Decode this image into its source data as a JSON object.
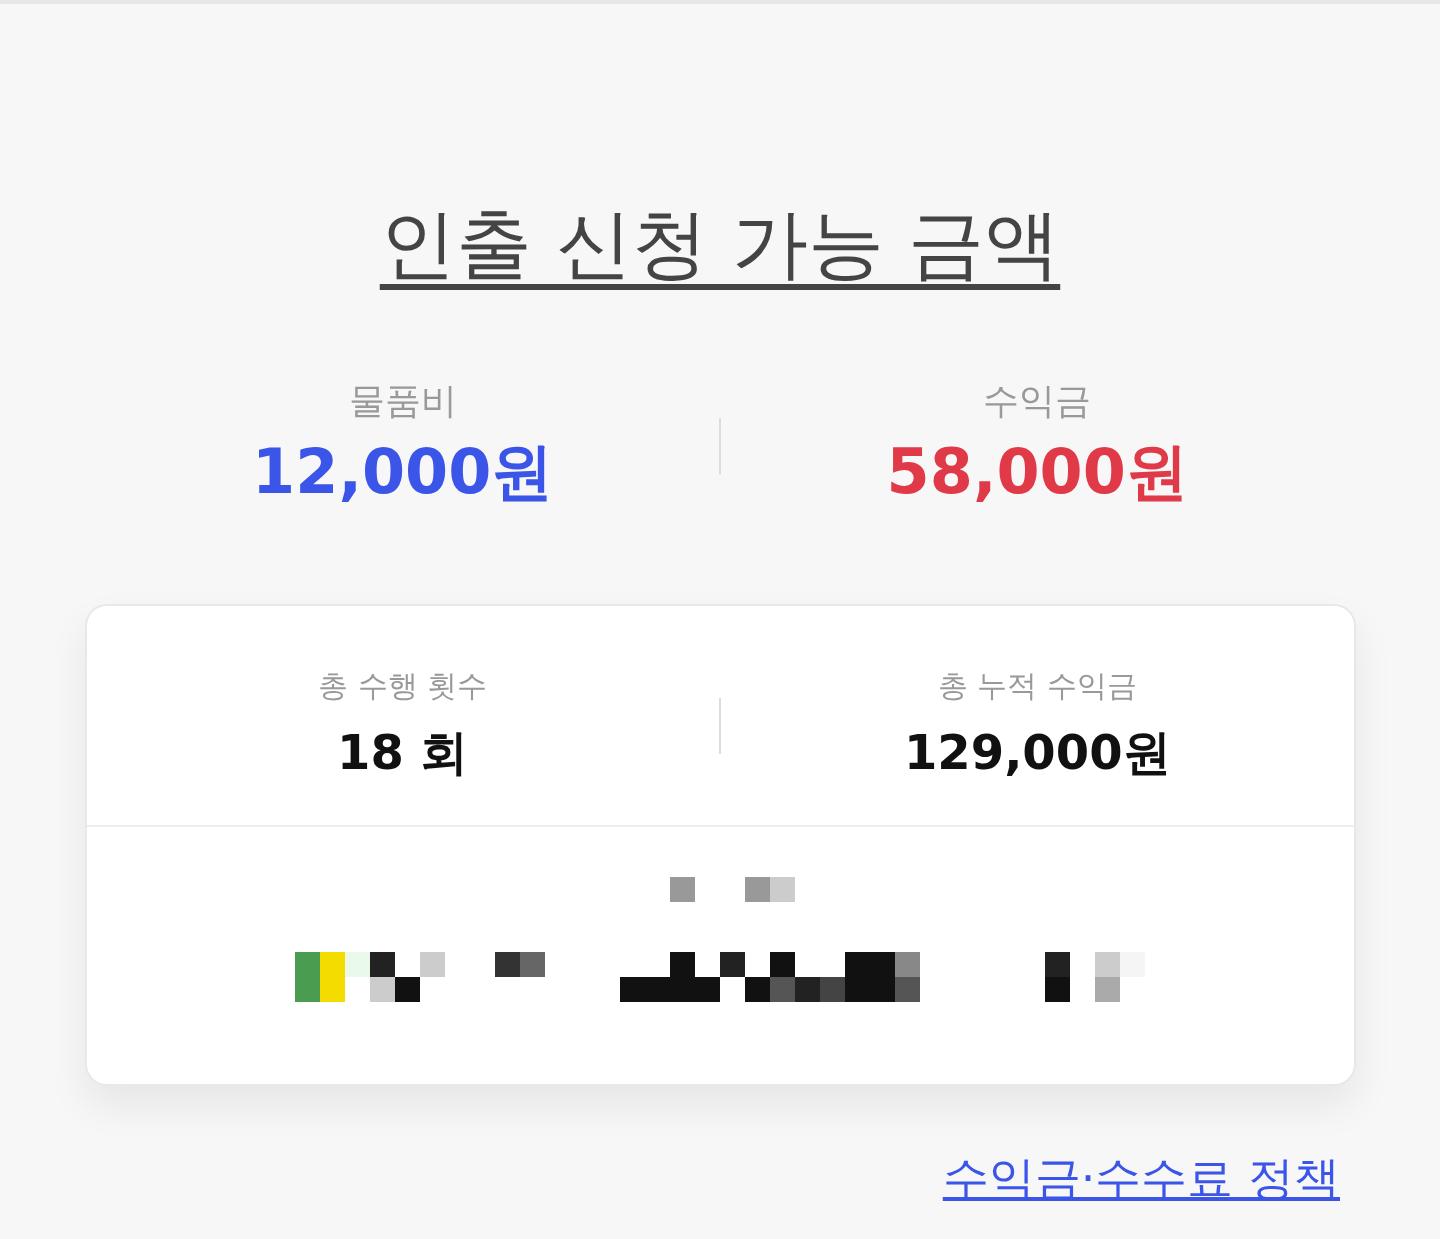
{
  "title": "인출 신청 가능 금액",
  "balances": [
    {
      "label": "물품비",
      "value": "12,000원",
      "color": "#3a55e8"
    },
    {
      "label": "수익금",
      "value": "58,000원",
      "color": "#e03a48"
    }
  ],
  "summary": [
    {
      "label": "총 수행 횟수",
      "value": "18 회"
    },
    {
      "label": "총 누적 수익금",
      "value": "129,000원"
    }
  ],
  "policy_link": "수익금·수수료 정책"
}
